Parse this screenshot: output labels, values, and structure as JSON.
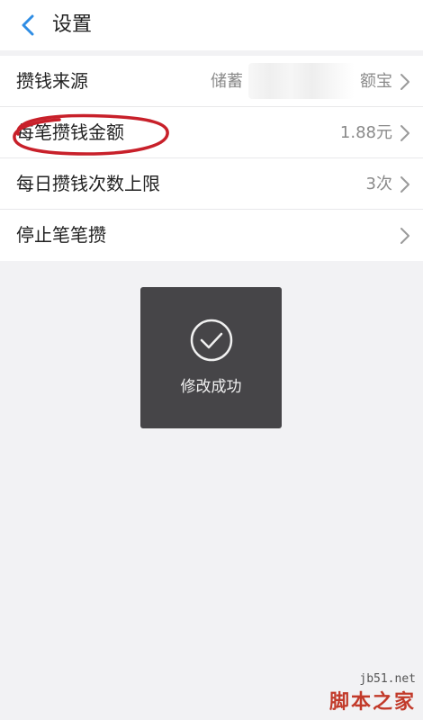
{
  "header": {
    "title": "设置",
    "back_icon": "chevron-left-icon",
    "accent": "#2f8de4"
  },
  "settings": [
    {
      "label": "攒钱来源",
      "value_prefix": "储蓄",
      "value_suffix": "额宝"
    },
    {
      "label": "每笔攒钱金额",
      "value": "1.88元"
    },
    {
      "label": "每日攒钱次数上限",
      "value": "3次"
    },
    {
      "label": "停止笔笔攒",
      "value": ""
    }
  ],
  "toast": {
    "text": "修改成功",
    "icon": "check-circle-icon"
  },
  "annotation": {
    "color": "#c8202a"
  },
  "watermark": {
    "url": "jb51.net",
    "name": "脚本之家"
  }
}
